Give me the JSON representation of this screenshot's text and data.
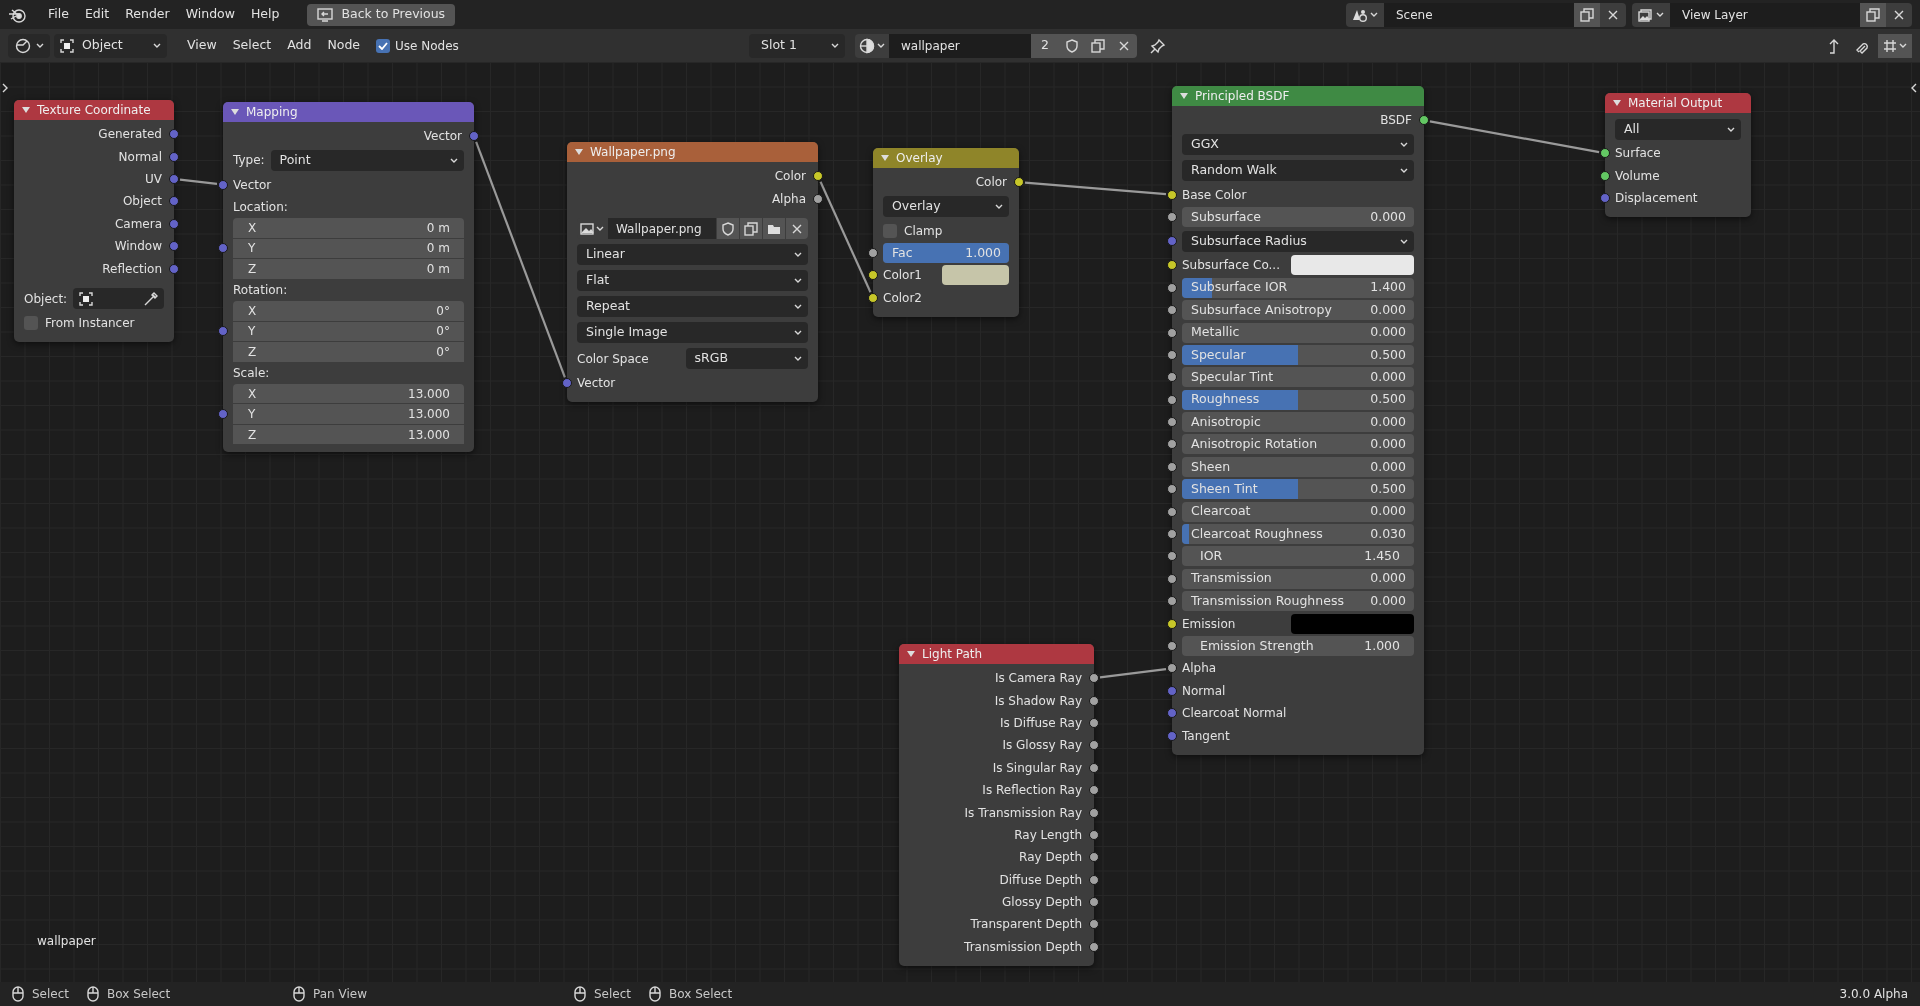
{
  "top_bar": {
    "menus": [
      "File",
      "Edit",
      "Render",
      "Window",
      "Help"
    ],
    "back_button": "Back to Previous",
    "scene": "Scene",
    "view_layer": "View Layer"
  },
  "editor_header": {
    "mode": "Object",
    "menus": [
      "View",
      "Select",
      "Add",
      "Node"
    ],
    "use_nodes": {
      "label": "Use Nodes",
      "checked": true
    },
    "slot": "Slot 1",
    "material": "wallpaper",
    "user_count": "2"
  },
  "nodes": [
    {
      "title": "Texture Coordinate",
      "color": "#ae3841",
      "rows": [
        {
          "kind": "output",
          "label": "Generated",
          "color": "#6363c7"
        },
        {
          "kind": "output",
          "label": "Normal",
          "color": "#6363c7"
        },
        {
          "kind": "output",
          "label": "UV",
          "color": "#6363c7"
        },
        {
          "kind": "output",
          "label": "Object",
          "color": "#6363c7"
        },
        {
          "kind": "output",
          "label": "Camera",
          "color": "#6363c7"
        },
        {
          "kind": "output",
          "label": "Window",
          "color": "#6363c7"
        },
        {
          "kind": "output",
          "label": "Reflection",
          "color": "#6363c7"
        },
        {
          "kind": "object",
          "label": "Object:"
        },
        {
          "kind": "checkbox",
          "label": "From Instancer",
          "checked": false
        }
      ]
    },
    {
      "title": "Mapping",
      "color": "#6a57b8",
      "rows": [
        {
          "kind": "output",
          "label": "Vector",
          "color": "#6363c7"
        },
        {
          "kind": "dropdown",
          "label": "Type:",
          "value": "Point"
        },
        {
          "kind": "input",
          "label": "Vector",
          "color": "#6363c7"
        },
        {
          "kind": "group",
          "label": "Location:",
          "color": "#6363c7",
          "fields": [
            {
              "axis": "X",
              "value": "0 m"
            },
            {
              "axis": "Y",
              "value": "0 m"
            },
            {
              "axis": "Z",
              "value": "0 m"
            }
          ]
        },
        {
          "kind": "group",
          "label": "Rotation:",
          "color": "#6363c7",
          "fields": [
            {
              "axis": "X",
              "value": "0°"
            },
            {
              "axis": "Y",
              "value": "0°"
            },
            {
              "axis": "Z",
              "value": "0°"
            }
          ]
        },
        {
          "kind": "group",
          "label": "Scale:",
          "color": "#6363c7",
          "fields": [
            {
              "axis": "X",
              "value": "13.000"
            },
            {
              "axis": "Y",
              "value": "13.000"
            },
            {
              "axis": "Z",
              "value": "13.000"
            }
          ]
        }
      ]
    },
    {
      "title": "Wallpaper.png",
      "color": "#a9603a",
      "rows": [
        {
          "kind": "output",
          "label": "Color",
          "color": "#c7c729"
        },
        {
          "kind": "output",
          "label": "Alpha",
          "color": "#a1a1a1"
        },
        {
          "kind": "image",
          "value": "Wallpaper.png"
        },
        {
          "kind": "dropdown",
          "value": "Linear"
        },
        {
          "kind": "dropdown",
          "value": "Flat"
        },
        {
          "kind": "dropdown",
          "value": "Repeat"
        },
        {
          "kind": "dropdown",
          "value": "Single Image"
        },
        {
          "kind": "dropdown",
          "label": "Color Space",
          "value": "sRGB"
        },
        {
          "kind": "input",
          "label": "Vector",
          "color": "#6363c7"
        }
      ]
    },
    {
      "title": "Overlay",
      "color": "#8f8529",
      "rows": [
        {
          "kind": "output",
          "label": "Color",
          "color": "#c7c729"
        },
        {
          "kind": "dropdown",
          "value": "Overlay"
        },
        {
          "kind": "checkbox",
          "label": "Clamp",
          "checked": false
        },
        {
          "kind": "slider",
          "label": "Fac",
          "value": "1.000",
          "level": 1,
          "color": "#a1a1a1"
        },
        {
          "kind": "swatch",
          "label": "Color1",
          "swatch": {
            "color": "#c6c5a9"
          },
          "color": "#c7c729"
        },
        {
          "kind": "input",
          "label": "Color2",
          "color": "#c7c729"
        }
      ]
    },
    {
      "title": "Principled BSDF",
      "color": "#3f8a44",
      "rows": [
        {
          "kind": "output",
          "label": "BSDF",
          "color": "#63c763"
        },
        {
          "kind": "dropdown",
          "value": "GGX"
        },
        {
          "kind": "dropdown",
          "value": "Random Walk"
        },
        {
          "kind": "input",
          "label": "Base Color",
          "color": "#c7c729"
        },
        {
          "kind": "slider",
          "label": "Subsurface",
          "value": "0.000",
          "level": 0,
          "color": "#a1a1a1"
        },
        {
          "kind": "dropdown",
          "value": "Subsurface Radius",
          "color": "#6363c7"
        },
        {
          "kind": "swatch",
          "label": "Subsurface Co...",
          "swatch": {
            "color": "#e8e8e8"
          },
          "color": "#c7c729"
        },
        {
          "kind": "slider",
          "label": "Subsurface IOR",
          "value": "1.400",
          "level": 0.13,
          "color": "#a1a1a1"
        },
        {
          "kind": "slider",
          "label": "Subsurface Anisotropy",
          "value": "0.000",
          "level": 0,
          "color": "#a1a1a1"
        },
        {
          "kind": "slider",
          "label": "Metallic",
          "value": "0.000",
          "level": 0,
          "color": "#a1a1a1"
        },
        {
          "kind": "slider",
          "label": "Specular",
          "value": "0.500",
          "level": 0.5,
          "color": "#a1a1a1"
        },
        {
          "kind": "slider",
          "label": "Specular Tint",
          "value": "0.000",
          "level": 0,
          "color": "#a1a1a1"
        },
        {
          "kind": "slider",
          "label": "Roughness",
          "value": "0.500",
          "level": 0.5,
          "color": "#a1a1a1"
        },
        {
          "kind": "slider",
          "label": "Anisotropic",
          "value": "0.000",
          "level": 0,
          "color": "#a1a1a1"
        },
        {
          "kind": "slider",
          "label": "Anisotropic Rotation",
          "value": "0.000",
          "level": 0,
          "color": "#a1a1a1"
        },
        {
          "kind": "slider",
          "label": "Sheen",
          "value": "0.000",
          "level": 0,
          "color": "#a1a1a1"
        },
        {
          "kind": "slider",
          "label": "Sheen Tint",
          "value": "0.500",
          "level": 0.5,
          "color": "#a1a1a1"
        },
        {
          "kind": "slider",
          "label": "Clearcoat",
          "value": "0.000",
          "level": 0,
          "color": "#a1a1a1"
        },
        {
          "kind": "slider",
          "label": "Clearcoat Roughness",
          "value": "0.030",
          "level": 0.03,
          "color": "#a1a1a1"
        },
        {
          "kind": "number",
          "label": "IOR",
          "value": "1.450",
          "color": "#a1a1a1"
        },
        {
          "kind": "slider",
          "label": "Transmission",
          "value": "0.000",
          "level": 0,
          "color": "#a1a1a1"
        },
        {
          "kind": "slider",
          "label": "Transmission Roughness",
          "value": "0.000",
          "level": 0,
          "color": "#a1a1a1"
        },
        {
          "kind": "swatch",
          "label": "Emission",
          "swatch": {
            "color": "#000000"
          },
          "color": "#c7c729"
        },
        {
          "kind": "number",
          "label": "Emission Strength",
          "value": "1.000",
          "color": "#a1a1a1"
        },
        {
          "kind": "input",
          "label": "Alpha",
          "color": "#a1a1a1"
        },
        {
          "kind": "input",
          "label": "Normal",
          "color": "#6363c7"
        },
        {
          "kind": "input",
          "label": "Clearcoat Normal",
          "color": "#6363c7"
        },
        {
          "kind": "input",
          "label": "Tangent",
          "color": "#6363c7"
        }
      ]
    },
    {
      "title": "Material Output",
      "color": "#ae3841",
      "rows": [
        {
          "kind": "dropdown",
          "value": "All"
        },
        {
          "kind": "input",
          "label": "Surface",
          "color": "#63c763"
        },
        {
          "kind": "input",
          "label": "Volume",
          "color": "#63c763"
        },
        {
          "kind": "input",
          "label": "Displacement",
          "color": "#6363c7"
        }
      ]
    },
    {
      "title": "Light Path",
      "color": "#ae3841",
      "rows": [
        {
          "kind": "output",
          "label": "Is Camera Ray",
          "color": "#a1a1a1"
        },
        {
          "kind": "output",
          "label": "Is Shadow Ray",
          "color": "#a1a1a1"
        },
        {
          "kind": "output",
          "label": "Is Diffuse Ray",
          "color": "#a1a1a1"
        },
        {
          "kind": "output",
          "label": "Is Glossy Ray",
          "color": "#a1a1a1"
        },
        {
          "kind": "output",
          "label": "Is Singular Ray",
          "color": "#a1a1a1"
        },
        {
          "kind": "output",
          "label": "Is Reflection Ray",
          "color": "#a1a1a1"
        },
        {
          "kind": "output",
          "label": "Is Transmission Ray",
          "color": "#a1a1a1"
        },
        {
          "kind": "output",
          "label": "Ray Length",
          "color": "#a1a1a1"
        },
        {
          "kind": "output",
          "label": "Ray Depth",
          "color": "#a1a1a1"
        },
        {
          "kind": "output",
          "label": "Diffuse Depth",
          "color": "#a1a1a1"
        },
        {
          "kind": "output",
          "label": "Glossy Depth",
          "color": "#a1a1a1"
        },
        {
          "kind": "output",
          "label": "Transparent Depth",
          "color": "#a1a1a1"
        },
        {
          "kind": "output",
          "label": "Transmission Depth",
          "color": "#a1a1a1"
        }
      ]
    }
  ],
  "canvas_label": "wallpaper",
  "status_bar": {
    "groups": [
      {
        "hints": [
          "Select",
          "Box Select"
        ]
      },
      {
        "hints": [
          "Pan View"
        ]
      },
      {
        "hints": [
          "Select",
          "Box Select"
        ]
      }
    ],
    "version": "3.0.0 Alpha"
  }
}
